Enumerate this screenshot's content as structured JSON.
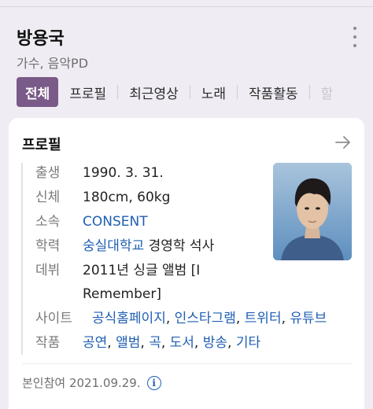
{
  "profile": {
    "name": "방용국",
    "subtitle": "가수, 음악PD"
  },
  "tabs": [
    {
      "label": "전체",
      "active": true
    },
    {
      "label": "프로필"
    },
    {
      "label": "최근영상"
    },
    {
      "label": "노래"
    },
    {
      "label": "작품활동"
    },
    {
      "label": "할"
    }
  ],
  "card": {
    "title": "프로필",
    "rows": {
      "birth": {
        "label": "출생",
        "value": "1990. 3. 31."
      },
      "body": {
        "label": "신체",
        "value": "180cm, 60kg"
      },
      "agency": {
        "label": "소속",
        "value": "CONSENT"
      },
      "education": {
        "label": "학력",
        "link": "숭실대학교",
        "value": "경영학 석사"
      },
      "debut": {
        "label": "데뷔",
        "value_line1": "2011년 싱글 앨범 [I",
        "value_line2": "Remember]"
      },
      "sites": {
        "label": "사이트",
        "links": [
          "공식홈페이지",
          "인스타그램",
          "트위터",
          "유튜브"
        ]
      },
      "works": {
        "label": "작품",
        "links": [
          "공연",
          "앨범",
          "곡",
          "도서",
          "방송",
          "기타"
        ]
      }
    },
    "footer": "본인참여 2021.09.29."
  },
  "icons": {
    "more": "more-vertical-icon",
    "arrow": "arrow-right-icon",
    "info": "info-icon"
  },
  "colors": {
    "accent": "#7a5a88",
    "link": "#1f5fb3"
  }
}
